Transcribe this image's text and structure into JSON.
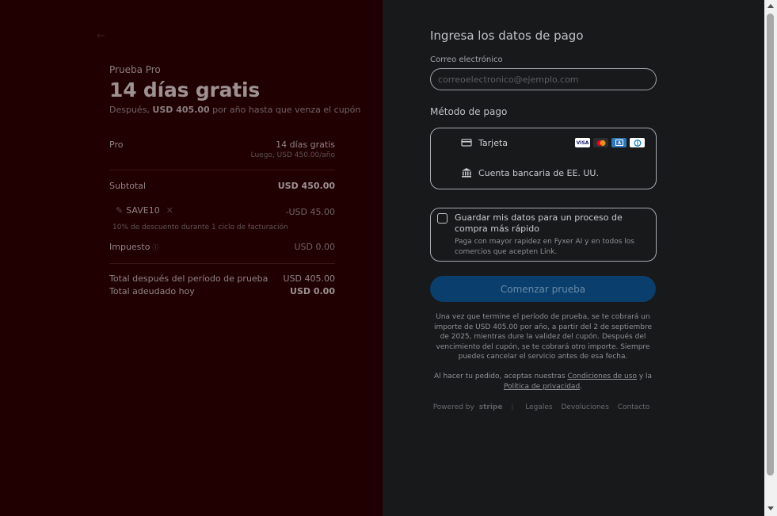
{
  "summary": {
    "back_label": "←",
    "product_name": "Prueba Pro",
    "headline": "14 días gratis",
    "subline_prefix": "Después, ",
    "subline_amount": "USD 405.00",
    "subline_suffix": " por año hasta que venza el cupón",
    "line_item_name": "Pro",
    "line_item_value": "14 días gratis",
    "line_item_sub": "Luego, USD 450.00/año",
    "subtotal_label": "Subtotal",
    "subtotal_value": "USD 450.00",
    "coupon_code": "SAVE10",
    "coupon_value": "-USD 45.00",
    "coupon_desc": "10% de descuento durante 1 ciclo de facturación",
    "tax_label": "Impuesto",
    "tax_value": "USD 0.00",
    "after_trial_label": "Total después del período de prueba",
    "after_trial_value": "USD 405.00",
    "due_today_label": "Total adeudado hoy",
    "due_today_value": "USD 0.00"
  },
  "payment": {
    "title": "Ingresa los datos de pago",
    "email_label": "Correo electrónico",
    "email_placeholder": "correoelectronico@ejemplo.com",
    "method_label": "Método de pago",
    "card_label": "Tarjeta",
    "bank_label": "Cuenta bancaria de EE. UU.",
    "card_brands": [
      "VISA",
      "MC",
      "AMEX",
      "DC"
    ],
    "save_title": "Guardar mis datos para un proceso de compra más rápido",
    "save_desc": "Paga con mayor rapidez en Fyxer AI y en todos los comercios que acepten Link.",
    "cta": "Comenzar prueba",
    "terms": "Una vez que termine el período de prueba, se te cobrará un importe de USD 405.00 por año, a partir del 2 de septiembre de 2025, mientras dure la validez del cupón. Después del vencimiento del cupón, se te cobrará otro importe. Siempre puedes cancelar el servicio antes de esa fecha.",
    "legal_prefix": "Al hacer tu pedido, aceptas nuestras ",
    "legal_terms_link": "Condiciones de uso",
    "legal_mid": " y la ",
    "legal_privacy_link": "Política de privacidad",
    "legal_suffix": ".",
    "powered_by": "Powered by",
    "stripe": "stripe",
    "footer_links": [
      "Legales",
      "Devoluciones",
      "Contacto"
    ]
  },
  "colors": {
    "left_bg": "#210002",
    "right_bg": "#17191a",
    "cta_bg": "#0a3e6c"
  }
}
